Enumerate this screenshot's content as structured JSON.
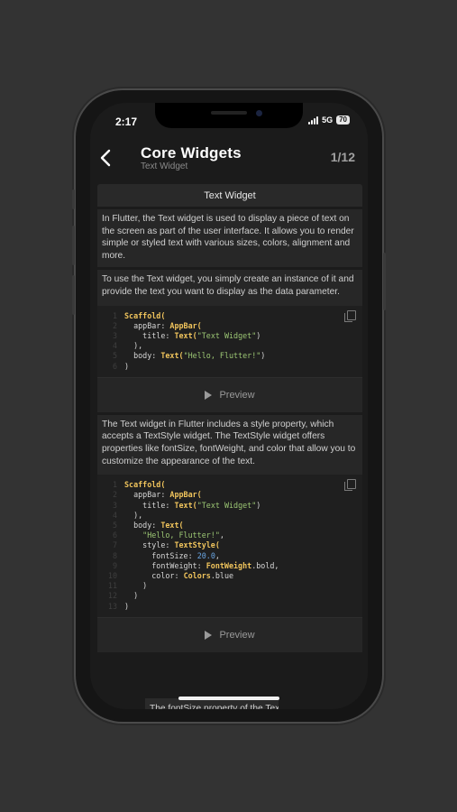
{
  "status": {
    "time": "2:17",
    "network": "5G",
    "battery": "70"
  },
  "appbar": {
    "back_icon": "chevron-left-icon",
    "title": "Core Widgets",
    "subtitle": "Text Widget",
    "pager": "1/12"
  },
  "section": {
    "header": "Text Widget"
  },
  "paragraphs": {
    "intro": "In Flutter, the Text widget is used to display a piece of text on the screen as part of the user interface. It allows you to render simple or styled text with various sizes, colors, alignment and more.",
    "usage": "To use the Text widget, you simply create an instance of it and provide the text you want to display as the data parameter.",
    "style": "The Text widget in Flutter includes a style property, which accepts a TextStyle widget. The TextStyle widget offers properties like fontSize, fontWeight, and color that allow you to customize the appearance of the text.",
    "peek": "The fontSize property of the TextStyle"
  },
  "code1": {
    "line_numbers": [
      "1",
      "2",
      "3",
      "4",
      "5",
      "6"
    ],
    "t": {
      "l1": "Scaffold(",
      "l2a": "  appBar: ",
      "l2b": "AppBar(",
      "l3a": "    title: ",
      "l3b": "Text(",
      "l3c": "\"Text Widget\"",
      "l3d": ")",
      "l4": "  ),",
      "l5a": "  body: ",
      "l5b": "Text(",
      "l5c": "\"Hello, Flutter!\"",
      "l5d": ")",
      "l6": ")"
    }
  },
  "code2": {
    "line_numbers": [
      "1",
      "2",
      "3",
      "4",
      "5",
      "6",
      "7",
      "8",
      "9",
      "10",
      "11",
      "12",
      "13"
    ],
    "t": {
      "l1": "Scaffold(",
      "l2a": "  appBar: ",
      "l2b": "AppBar(",
      "l3a": "    title: ",
      "l3b": "Text(",
      "l3c": "\"Text Widget\"",
      "l3d": ")",
      "l4": "  ),",
      "l5a": "  body: ",
      "l5b": "Text(",
      "l6a": "    ",
      "l6b": "\"Hello, Flutter!\"",
      "l6c": ",",
      "l7a": "    style: ",
      "l7b": "TextStyle(",
      "l8a": "      fontSize: ",
      "l8b": "20.0",
      "l8c": ",",
      "l9a": "      fontWeight: ",
      "l9b": "FontWeight",
      "l9c": ".bold,",
      "l10a": "      color: ",
      "l10b": "Colors",
      "l10c": ".blue",
      "l11": "    )",
      "l12": "  )",
      "l13": ")"
    }
  },
  "preview_label": "Preview",
  "colors": {
    "background": "#333333",
    "keyword": "#f0c45c",
    "string": "#9cc774",
    "number": "#6aa6e4"
  }
}
